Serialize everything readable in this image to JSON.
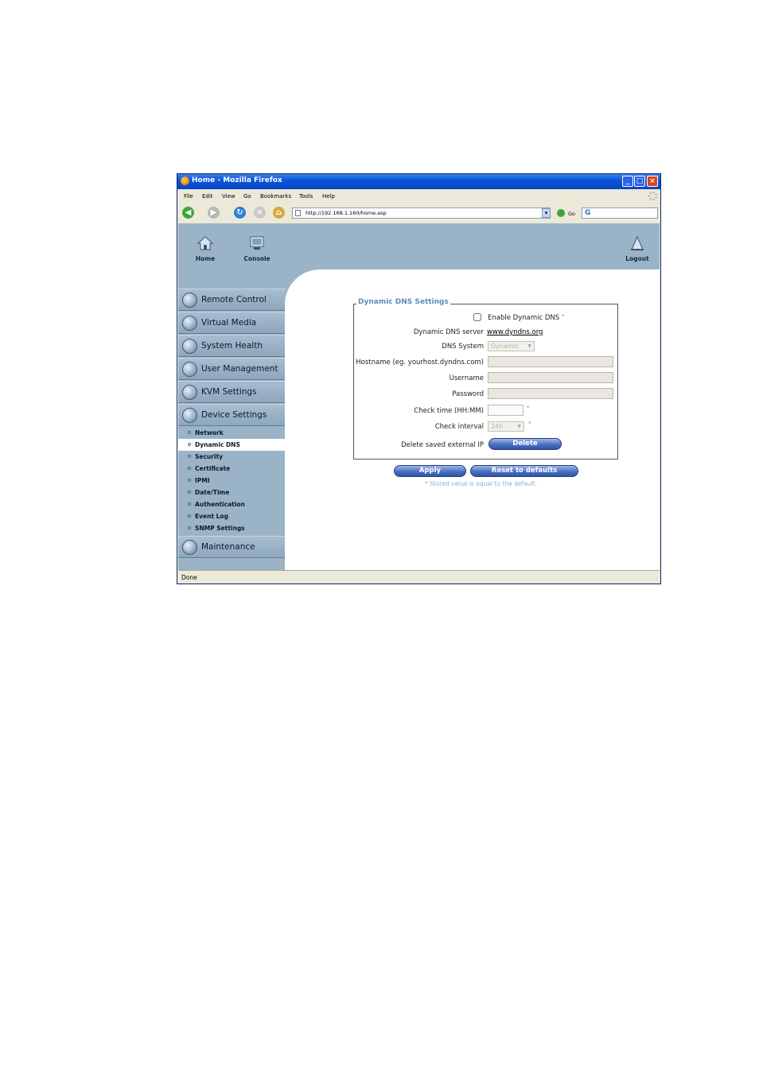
{
  "window": {
    "title": "Home - Mozilla Firefox"
  },
  "menu": [
    "File",
    "Edit",
    "View",
    "Go",
    "Bookmarks",
    "Tools",
    "Help"
  ],
  "address": {
    "url": "http://192.168.1.160/home.asp",
    "go_label": "Go"
  },
  "topnav": {
    "home": "Home",
    "console": "Console",
    "logout": "Logout"
  },
  "sidebar": {
    "remote_control": "Remote Control",
    "virtual_media": "Virtual Media",
    "system_health": "System Health",
    "user_management": "User Management",
    "kvm_settings": "KVM Settings",
    "device_settings": "Device Settings",
    "sub": [
      "Network",
      "Dynamic DNS",
      "Security",
      "Certificate",
      "IPMI",
      "Date/Time",
      "Authentication",
      "Event Log",
      "SNMP Settings"
    ],
    "maintenance": "Maintenance"
  },
  "form": {
    "legend": "Dynamic DNS Settings",
    "enable_label": "Enable Dynamic DNS",
    "server_label": "Dynamic DNS server",
    "server_value": "www.dyndns.org",
    "system_label": "DNS System",
    "system_value": "Dynamic",
    "hostname_label": "Hostname (eg. yourhost.dyndns.com)",
    "username_label": "Username",
    "password_label": "Password",
    "checktime_label": "Check time (HH:MM)",
    "interval_label": "Check interval",
    "interval_value": "24h",
    "delete_label": "Delete saved external IP",
    "delete_button": "Delete",
    "star": "*",
    "apply": "Apply",
    "reset": "Reset to defaults",
    "note": "* Stored value is equal to the default."
  },
  "status": "Done"
}
